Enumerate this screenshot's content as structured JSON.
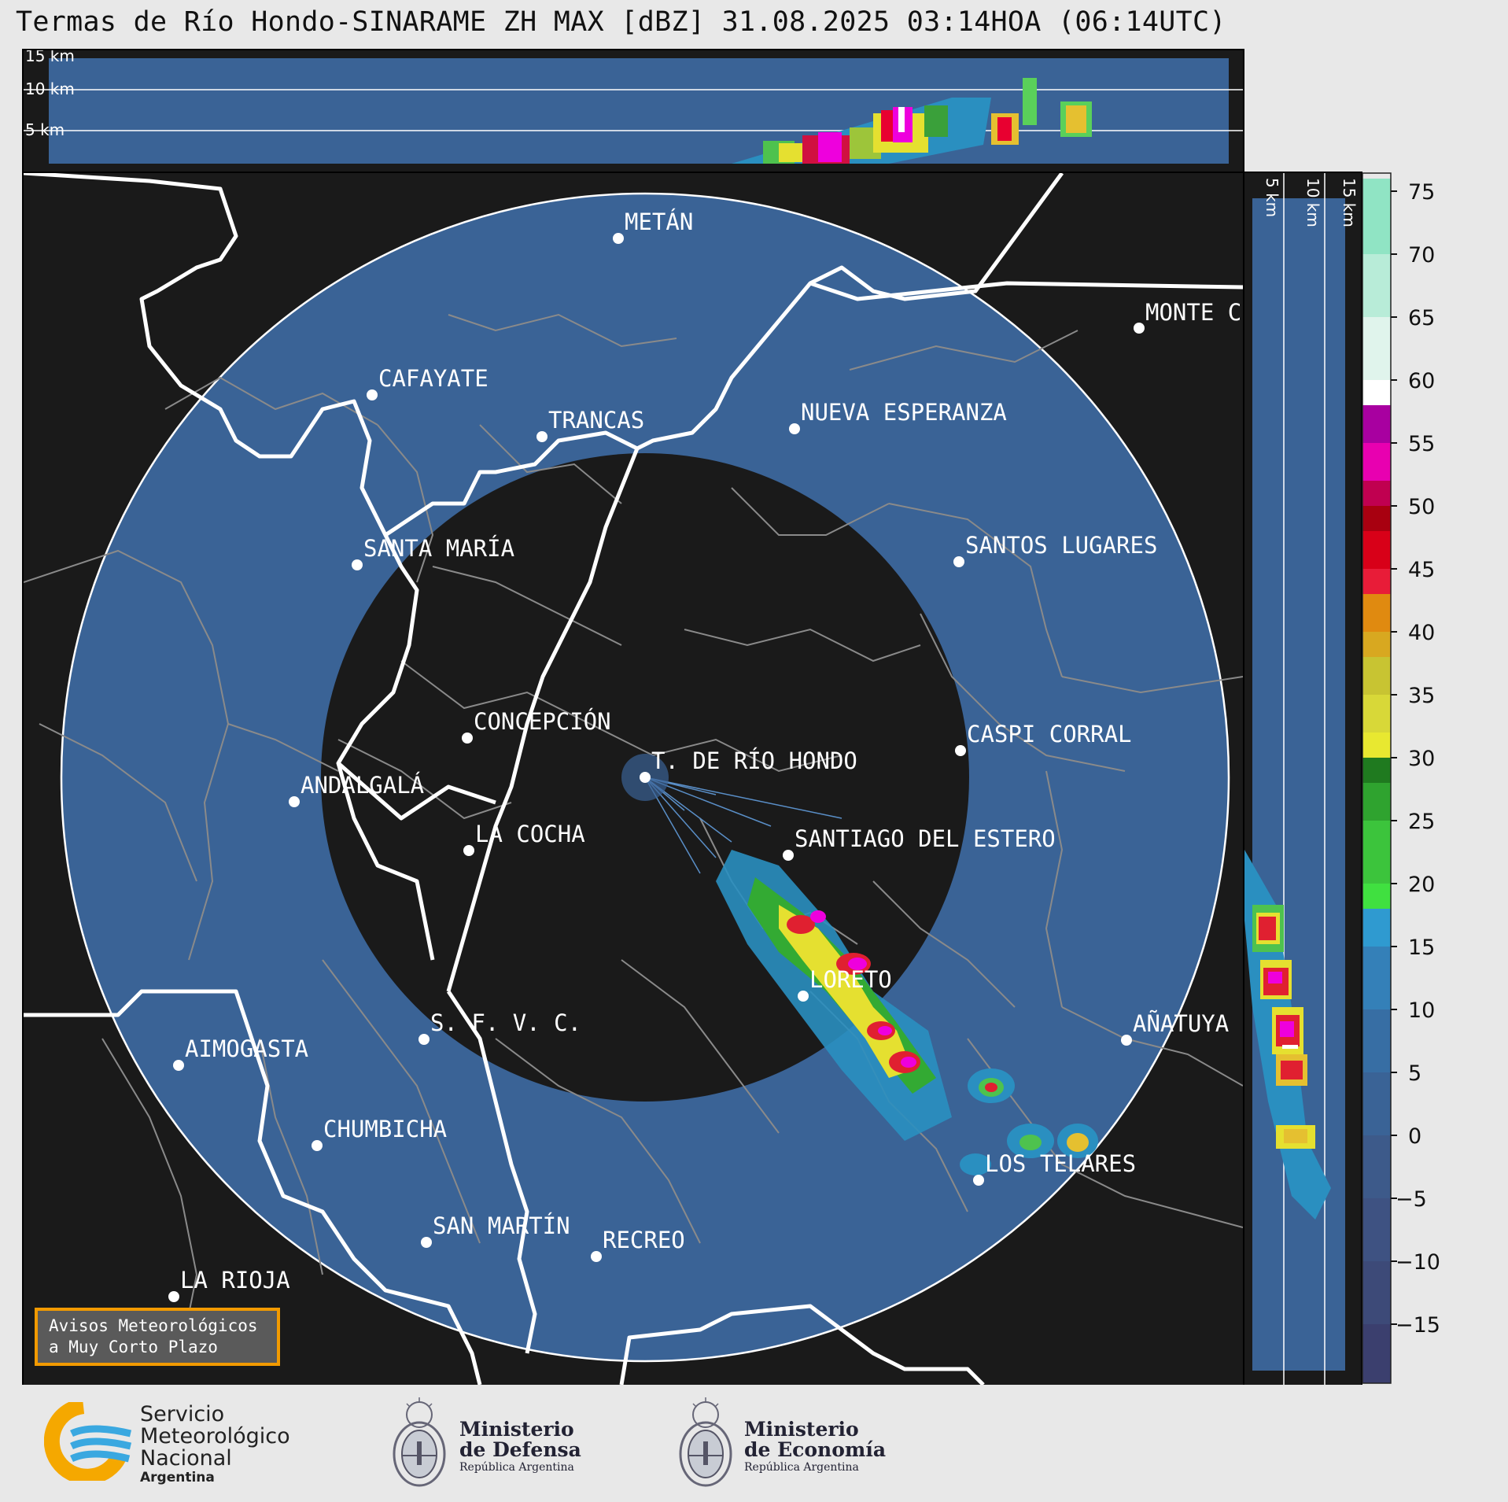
{
  "title": "Termas de Río Hondo-SINARAME ZH MAX [dBZ] 31.08.2025 03:14HOA (06:14UTC)",
  "height_labels": [
    "15 km",
    "10 km",
    "5 km"
  ],
  "cities": [
    {
      "name": "METÁN"
    },
    {
      "name": "MONTE C"
    },
    {
      "name": "CAFAYATE"
    },
    {
      "name": "TRANCAS"
    },
    {
      "name": "NUEVA ESPERANZA"
    },
    {
      "name": "SANTA MARÍA"
    },
    {
      "name": "SANTOS LUGARES"
    },
    {
      "name": "CONCEPCIÓN"
    },
    {
      "name": "T. DE RÍO HONDO"
    },
    {
      "name": "CASPI CORRAL"
    },
    {
      "name": "ANDALGALÁ"
    },
    {
      "name": "LA COCHA"
    },
    {
      "name": "SANTIAGO DEL ESTERO"
    },
    {
      "name": "LORETO"
    },
    {
      "name": "S. F. V. C."
    },
    {
      "name": "AÑATUYA"
    },
    {
      "name": "AIMOGASTA"
    },
    {
      "name": "CHUMBICHA"
    },
    {
      "name": "LOS TELARES"
    },
    {
      "name": "SAN MARTÍN"
    },
    {
      "name": "RECREO"
    },
    {
      "name": "LA RIOJA"
    }
  ],
  "colorbar": {
    "ticks": [
      "75",
      "70",
      "65",
      "60",
      "55",
      "50",
      "45",
      "40",
      "35",
      "30",
      "25",
      "20",
      "15",
      "10",
      "5",
      "0",
      "−5",
      "−10",
      "−15"
    ],
    "colors": {
      "blue": "#3a6396",
      "background": "#1a1a1a"
    }
  },
  "avisos": {
    "line1": "Avisos Meteorológicos",
    "line2": "a Muy Corto Plazo"
  },
  "footer": {
    "smn": {
      "line1": "Servicio",
      "line2": "Meteorológico",
      "line3": "Nacional",
      "line4": "Argentina"
    },
    "defensa": {
      "line1": "Ministerio",
      "line2": "de Defensa",
      "line3": "República Argentina"
    },
    "economia": {
      "line1": "Ministerio",
      "line2": "de Economía",
      "line3": "República Argentina"
    }
  }
}
